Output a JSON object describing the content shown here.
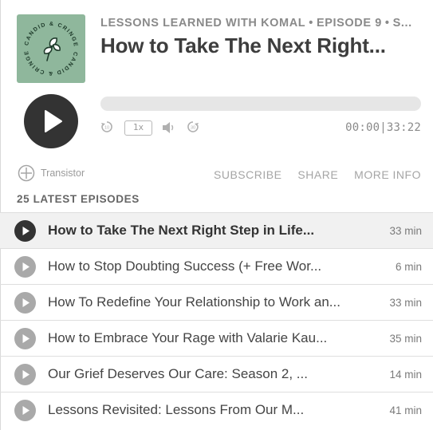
{
  "header": {
    "show_name": "LESSONS LEARNED WITH KOMAL",
    "separator": "•",
    "episode_label": "EPISODE 9",
    "meta_suffix": "S...",
    "episode_title": "How to Take The Next Right...",
    "artwork_text": "CANDID & CRINGE"
  },
  "player": {
    "speed": "1x",
    "time": "00:00|33:22",
    "skip_back_icon": "rewind-10-icon",
    "skip_forward_icon": "forward-30-icon",
    "volume_icon": "volume-icon",
    "progress": 0
  },
  "brand": {
    "label": "Transistor"
  },
  "links": {
    "subscribe": "SUBSCRIBE",
    "share": "SHARE",
    "more_info": "MORE INFO"
  },
  "list": {
    "heading": "25 LATEST EPISODES",
    "episodes": [
      {
        "title": "How to Take The Next Right Step in Life...",
        "duration": "33 min"
      },
      {
        "title": "How to Stop Doubting Success (+ Free Wor...",
        "duration": "6 min"
      },
      {
        "title": "How To Redefine Your Relationship to Work an...",
        "duration": "33 min"
      },
      {
        "title": "How to Embrace Your Rage with Valarie Kau...",
        "duration": "35 min"
      },
      {
        "title": "Our Grief Deserves Our Care: Season 2, ...",
        "duration": "14 min"
      },
      {
        "title": "Lessons Revisited: Lessons From Our M...",
        "duration": "41 min"
      }
    ]
  },
  "colors": {
    "artwork_bg": "#8fb79c",
    "play_dark": "#333333",
    "play_muted": "#a9a9a9",
    "active_row": "#f1f1f1"
  }
}
